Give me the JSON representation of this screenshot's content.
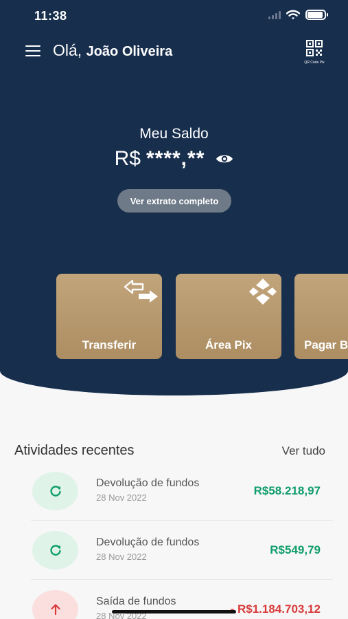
{
  "status_bar": {
    "time": "11:38"
  },
  "header": {
    "greeting": "Olá,",
    "user_name": "João Oliveira",
    "qr_label": "QR Code Pix",
    "menu_icon": "hamburger-menu-icon",
    "qr_icon": "qr-code-icon"
  },
  "balance": {
    "title": "Meu Saldo",
    "currency": "R$",
    "masked_value": "****,**",
    "visibility_icon": "eye-icon",
    "statement_button": "Ver extrato completo"
  },
  "actions": [
    {
      "label": "Transferir",
      "icon": "transfer-arrows-icon"
    },
    {
      "label": "Área Pix",
      "icon": "pix-icon"
    },
    {
      "label": "Pagar B",
      "icon": ""
    }
  ],
  "activities": {
    "title": "Atividades recentes",
    "see_all": "Ver tudo",
    "items": [
      {
        "title": "Devolução de fundos",
        "date": "28 Nov 2022",
        "amount": "R$58.218,97",
        "type": "refund",
        "icon": "refresh-icon"
      },
      {
        "title": "Devolução de fundos",
        "date": "28 Nov 2022",
        "amount": "R$549,79",
        "type": "refund",
        "icon": "refresh-icon"
      },
      {
        "title": "Saída de fundos",
        "date": "28 Nov 2022",
        "amount": "- R$1.184.703,12",
        "type": "outgoing",
        "icon": "arrow-up-icon"
      }
    ]
  },
  "colors": {
    "primary": "#172e4d",
    "gold": "#b8996e",
    "positive": "#0f9d6b",
    "negative": "#d93b3b",
    "positive_bg": "#dff3e8",
    "negative_bg": "#fbdede"
  }
}
